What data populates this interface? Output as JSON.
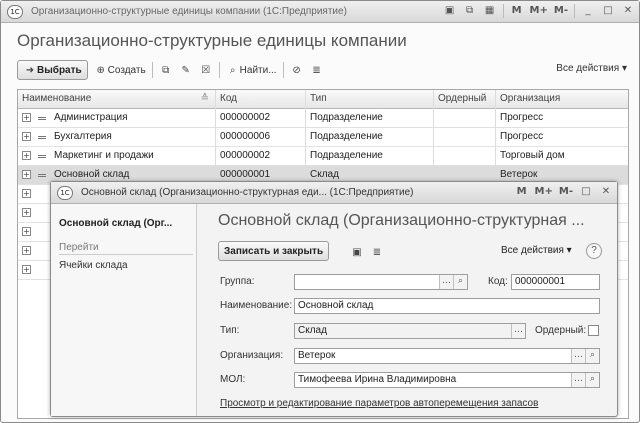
{
  "main_window": {
    "logo": "1С",
    "title": "Организационно-структурные единицы компании (1С:Предприятие)",
    "title_icons": [
      "M",
      "M+",
      "M-"
    ],
    "form_title": "Организационно-структурные единицы компании",
    "toolbar": {
      "select_label": "Выбрать",
      "create_label": "Создать",
      "find_label": "Найти...",
      "all_actions_label": "Все действия"
    },
    "table": {
      "columns": [
        "Наименование",
        "Код",
        "Тип",
        "Ордерный",
        "Организация"
      ],
      "rows": [
        {
          "name": "Администрация",
          "code": "000000002",
          "type": "Подразделение",
          "ordered": "",
          "org": "Прогресс"
        },
        {
          "name": "Бухгалтерия",
          "code": "000000006",
          "type": "Подразделение",
          "ordered": "",
          "org": "Прогресс"
        },
        {
          "name": "Маркетинг и продажи",
          "code": "000000002",
          "type": "Подразделение",
          "ordered": "",
          "org": "Торговый дом"
        },
        {
          "name": "Основной склад",
          "code": "000000001",
          "type": "Склад",
          "ordered": "",
          "org": "Ветерок"
        }
      ]
    }
  },
  "sub_window": {
    "logo": "1С",
    "title": "Основной склад (Организационно-структурная еди... (1С:Предприятие)",
    "title_icons": [
      "M",
      "M+",
      "M-"
    ],
    "left_panel": {
      "title": "Основной склад (Орг...",
      "goto_heading": "Перейти",
      "links": [
        "Ячейки склада"
      ]
    },
    "heading": "Основной склад (Организационно-структурная ...",
    "save_close_label": "Записать и закрыть",
    "all_actions_label": "Все действия",
    "fields": {
      "group_label": "Группа:",
      "group_value": "",
      "code_label": "Код:",
      "code_value": "000000001",
      "name_label": "Наименование:",
      "name_value": "Основной склад",
      "type_label": "Тип:",
      "type_value": "Склад",
      "ordered_label": "Ордерный:",
      "ordered_checked": false,
      "org_label": "Организация:",
      "org_value": "Ветерок",
      "mol_label": "МОЛ:",
      "mol_value": "Тимофеева Ирина Владимировна"
    },
    "bottom_link": "Просмотр и редактирование параметров автоперемещения запасов"
  }
}
